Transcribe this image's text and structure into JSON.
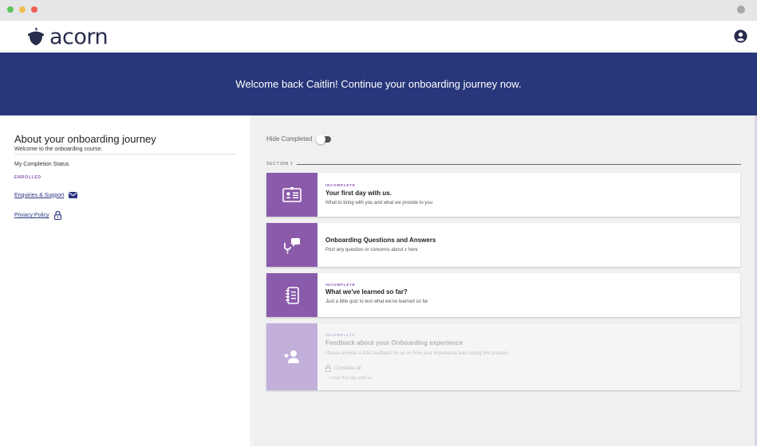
{
  "brand": {
    "name": "acorn",
    "color": "#272c4c"
  },
  "banner": {
    "message": "Welcome back Caitlin! Continue your onboarding journey now.",
    "bg": "#28377b"
  },
  "about": {
    "title": "About your onboarding journey",
    "subtitle": "Welcome to the onboarding course.",
    "status_label": "My Completion Status",
    "status_value": "ENROLLED",
    "links": [
      {
        "label": "Enquiries & Support",
        "icon": "envelope-icon"
      },
      {
        "label": "Privacy Policy",
        "icon": "lock-icon"
      }
    ]
  },
  "controls": {
    "hide_completed_label": "Hide Completed",
    "hide_completed_on": false
  },
  "section": {
    "label": "SECTION 1"
  },
  "accent": "#8b5bab",
  "cards": [
    {
      "status": "INCOMPLETE",
      "title": "Your first day with us.",
      "description": "What to bring with you and what we provide to you",
      "icon": "id-card-icon",
      "locked": false
    },
    {
      "status": "",
      "title": "Onboarding Questions and Answers",
      "description": "Post any question or concerns about x here",
      "icon": "chat-question-icon",
      "locked": false
    },
    {
      "status": "INCOMPLETE",
      "title": "What we've learned so far?",
      "description": "Just a little quiz to test what we've learned so far",
      "icon": "notebook-icon",
      "locked": false
    },
    {
      "status": "INCOMPLETE",
      "title": "Feedback about your Onboarding experience",
      "description": "Please provide a little feedback for us on how your experience was during this process",
      "icon": "user-heart-icon",
      "locked": true,
      "lock_text": "Complete all",
      "prerequisite": "• Your first day with us."
    }
  ]
}
